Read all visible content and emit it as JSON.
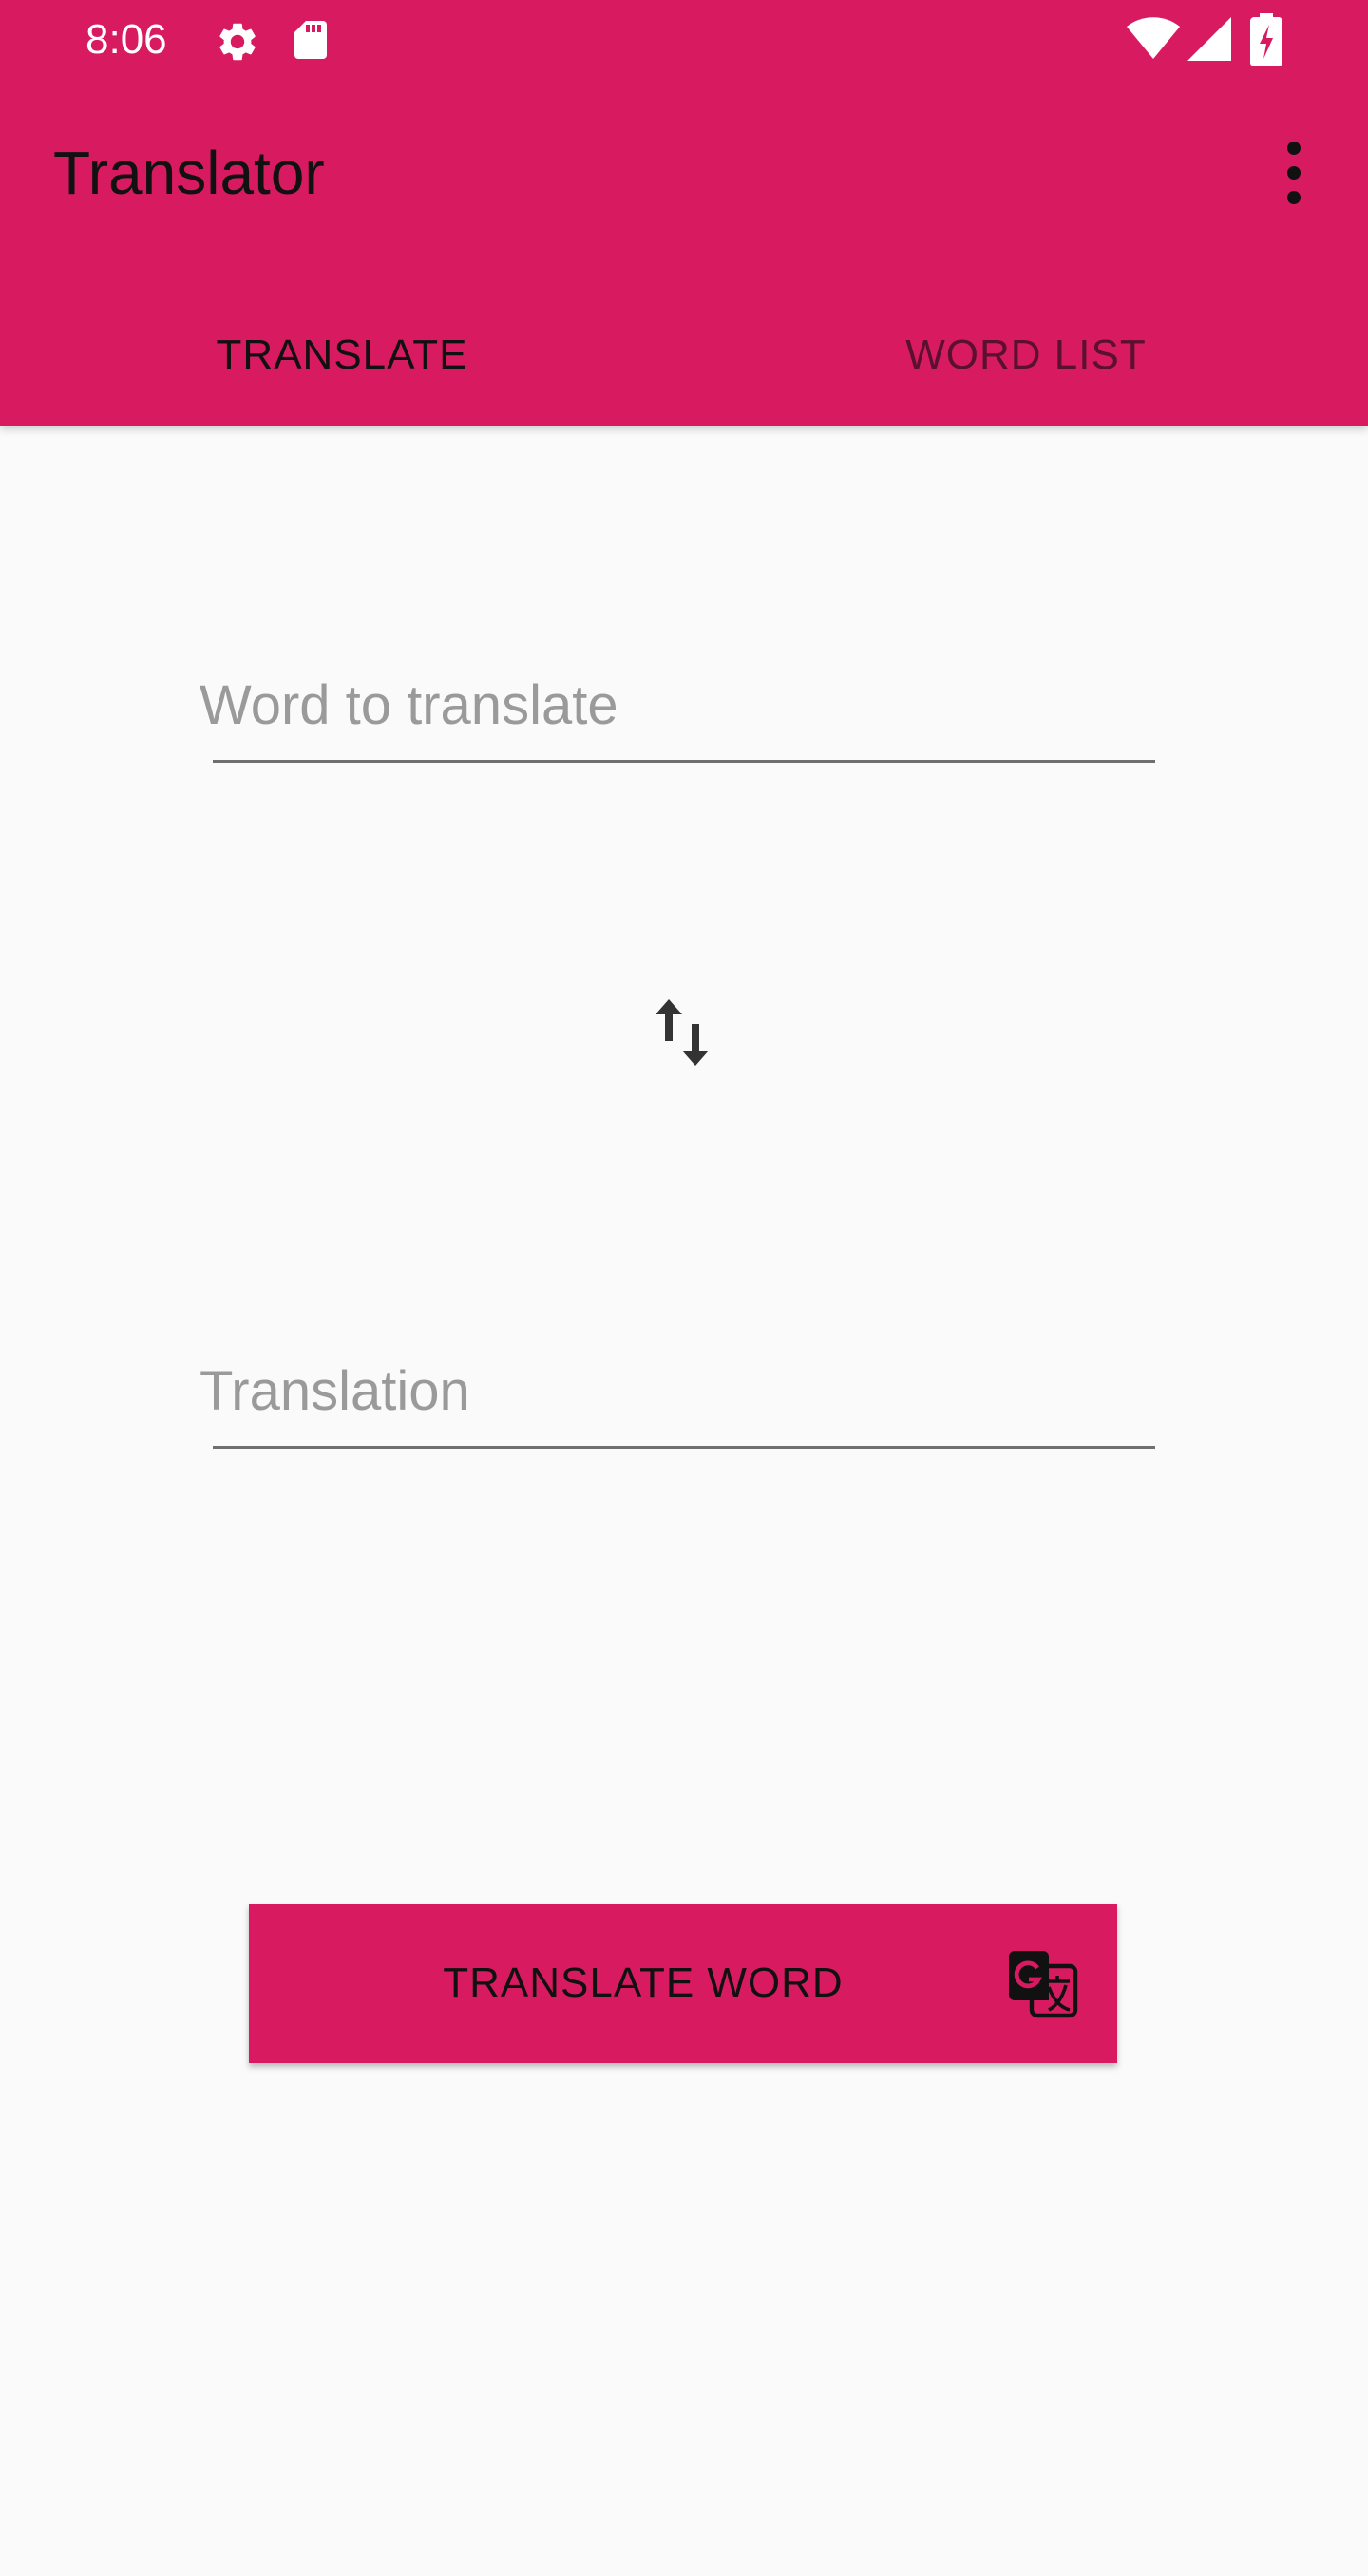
{
  "status_bar": {
    "time": "8:06",
    "icons": [
      "gear-icon",
      "sd-card-icon",
      "wifi-icon",
      "signal-icon",
      "battery-charging-icon"
    ]
  },
  "toolbar": {
    "title": "Translator",
    "overflow_icon": "more-vert-icon"
  },
  "tabs": [
    {
      "label": "TRANSLATE",
      "active": true
    },
    {
      "label": "WORD LIST",
      "active": false
    }
  ],
  "form": {
    "source_placeholder": "Word to translate",
    "swap_icon": "swap-vertical-icon",
    "target_placeholder": "Translation"
  },
  "action": {
    "button_label": "TRANSLATE WORD",
    "button_icon": "google-translate-icon"
  },
  "colors": {
    "primary": "#d81b60",
    "background": "#fafafa",
    "text_primary": "#111111",
    "hint": "#9a9a9a"
  }
}
